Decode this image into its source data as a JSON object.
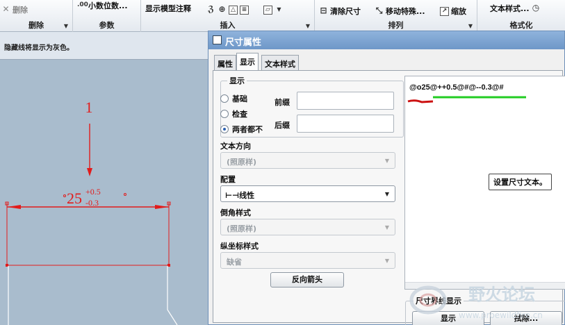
{
  "ribbon": {
    "delete_label": "删除",
    "group_delete": "删除",
    "decimal_places_label": "小数位数...",
    "group_params": "参数",
    "show_model_annotation_label": "显示模型注释",
    "group_insert": "插入",
    "clean_dims_label": "清除尺寸",
    "move_special_label": "移动特殊...",
    "zoom_label": "缩放",
    "group_arrange": "排列",
    "text_style_label": "文本样式...",
    "group_format": "格式化"
  },
  "message": "隐藏线将显示为灰色。",
  "drawing": {
    "callout_number": "1",
    "dim_nominal": "25",
    "dim_upper_tol": "+0.5",
    "dim_lower_tol": "-0.3"
  },
  "dialog": {
    "title": "尺寸属性",
    "tabs": [
      "属性",
      "显示",
      "文本样式"
    ],
    "active_tab": "显示",
    "display_group": {
      "legend": "显示",
      "options": [
        "基础",
        "检查",
        "两者都不"
      ],
      "selected": "两者都不",
      "prefix_label": "前缀",
      "prefix_value": "",
      "suffix_label": "后缀",
      "suffix_value": ""
    },
    "text_direction_label": "文本方向",
    "text_direction_value": "(照原样)",
    "config_label": "配置",
    "config_value": "线性",
    "chamfer_style_label": "倒角样式",
    "chamfer_style_value": "(照原样)",
    "ordinate_style_label": "纵坐标样式",
    "ordinate_style_value": "缺省",
    "flip_arrows_label": "反向箭头",
    "dim_text": "@o25@++0.5@#@--0.3@#",
    "tooltip": "设置尺寸文本。",
    "witness_line_legend": "尺寸界线显示",
    "show_button": "显示",
    "erase_button": "拭除..."
  },
  "watermark": {
    "text": "野火论坛",
    "url": "www.proewildfire.cn"
  },
  "colors": {
    "dimension_red": "#e21b1b",
    "underline_red": "#cc1111",
    "underline_green": "#22cc22",
    "titlebar_blue": "#7aa0d0"
  }
}
